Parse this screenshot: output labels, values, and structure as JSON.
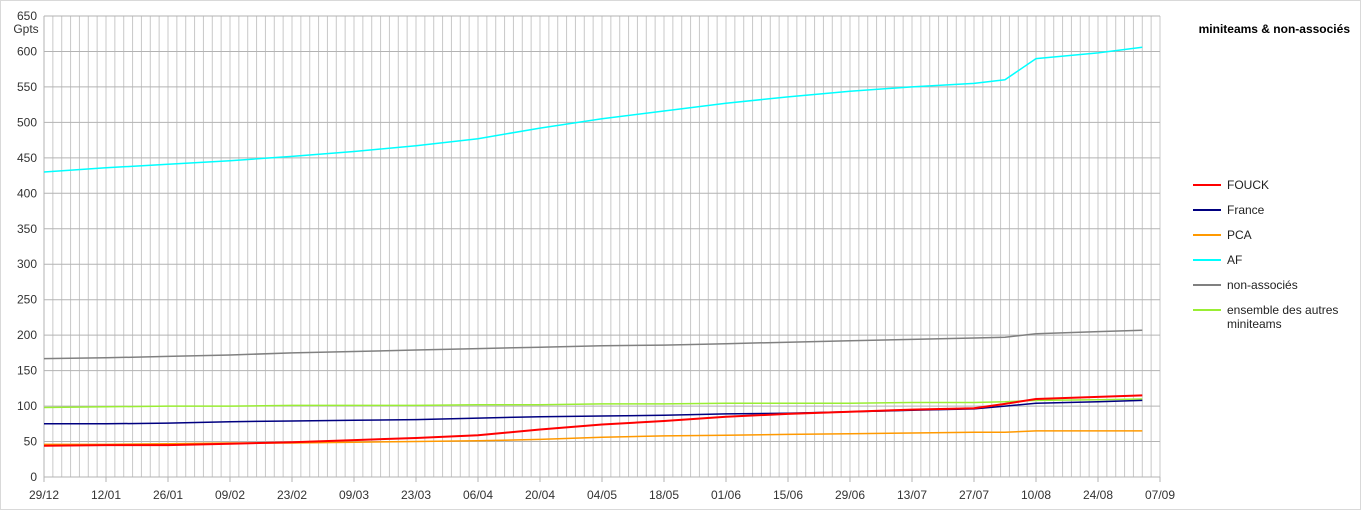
{
  "chart_data": {
    "type": "line",
    "title": "miniteams & non-associés",
    "xlabel": "",
    "ylabel": "Gpts",
    "ylim": [
      0,
      650
    ],
    "yticks": [
      "0",
      "50",
      "100",
      "150",
      "200",
      "250",
      "300",
      "350",
      "400",
      "450",
      "500",
      "550",
      "600",
      "650"
    ],
    "xticks": [
      "29/12",
      "12/01",
      "26/01",
      "09/02",
      "23/02",
      "09/03",
      "23/03",
      "06/04",
      "20/04",
      "04/05",
      "18/05",
      "01/06",
      "15/06",
      "29/06",
      "13/07",
      "27/07",
      "10/08",
      "24/08",
      "07/09"
    ],
    "grid": true,
    "legend_position": "right",
    "x_unit": "days from 29/12",
    "x": [
      0,
      14,
      28,
      42,
      56,
      70,
      84,
      98,
      112,
      126,
      140,
      154,
      168,
      182,
      196,
      210,
      217,
      224,
      238,
      248
    ],
    "series": [
      {
        "name": "FOUCK",
        "color": "#ff0000",
        "values": [
          44,
          45,
          45,
          47,
          49,
          52,
          55,
          59,
          67,
          74,
          79,
          85,
          89,
          92,
          95,
          97,
          103,
          110,
          113,
          115
        ]
      },
      {
        "name": "France",
        "color": "#000080",
        "values": [
          75,
          75,
          76,
          78,
          79,
          80,
          81,
          83,
          85,
          86,
          87,
          89,
          90,
          92,
          94,
          96,
          100,
          104,
          106,
          108
        ]
      },
      {
        "name": "PCA",
        "color": "#ff9900",
        "values": [
          46,
          46,
          47,
          48,
          48,
          49,
          50,
          51,
          53,
          56,
          58,
          59,
          60,
          61,
          62,
          63,
          63,
          65,
          65,
          65
        ]
      },
      {
        "name": "AF",
        "color": "#00ffff",
        "values": [
          430,
          436,
          441,
          446,
          452,
          459,
          467,
          477,
          492,
          505,
          516,
          527,
          536,
          544,
          550,
          555,
          560,
          590,
          598,
          606
        ]
      },
      {
        "name": "non-associés",
        "color": "#808080",
        "values": [
          167,
          168,
          170,
          172,
          175,
          177,
          179,
          181,
          183,
          185,
          186,
          188,
          190,
          192,
          194,
          196,
          197,
          202,
          205,
          207
        ]
      },
      {
        "name": "ensemble des autres miniteams",
        "color": "#99ee33",
        "values": [
          98,
          99,
          100,
          100,
          101,
          101,
          101,
          102,
          102,
          103,
          103,
          104,
          104,
          104,
          105,
          105,
          106,
          108,
          109,
          110
        ]
      }
    ]
  }
}
